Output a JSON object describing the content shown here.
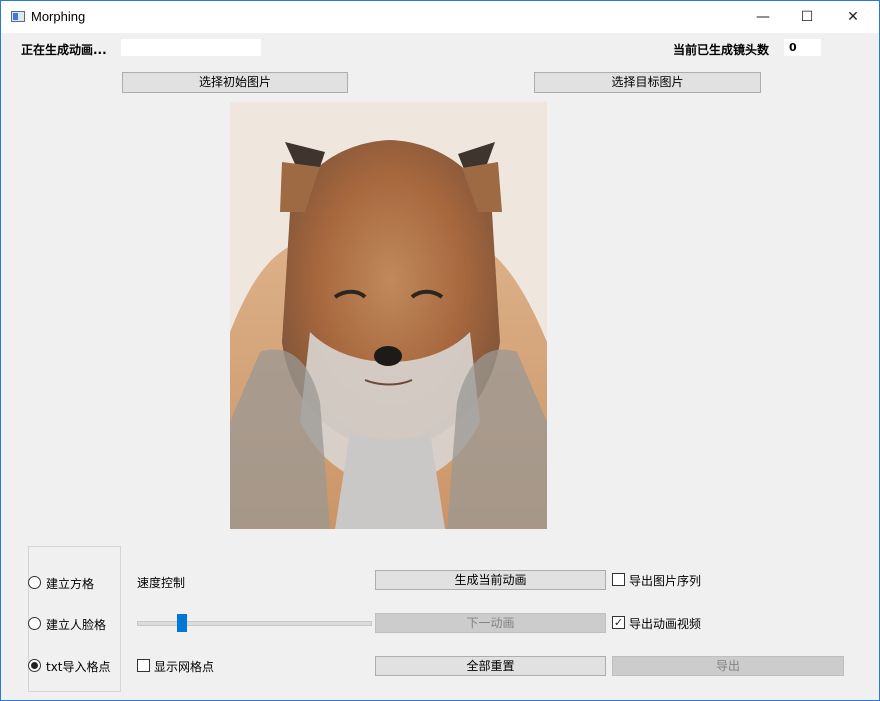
{
  "window": {
    "title": "Morphing",
    "controls": {
      "minimize": "—",
      "maximize": "☐",
      "close": "✕"
    }
  },
  "status": {
    "generating_label": "正在生成动画...",
    "frames_label": "当前已生成镜头数",
    "frames_value": "0"
  },
  "buttons": {
    "select_source": "选择初始图片",
    "select_target": "选择目标图片",
    "generate_current": "生成当前动画",
    "next_animation": "下一动画",
    "reset_all": "全部重置",
    "export": "导出"
  },
  "grid_mode": {
    "options": [
      {
        "label": "建立方格",
        "checked": false
      },
      {
        "label": "建立人脸格",
        "checked": false
      },
      {
        "label": "txt导入格点",
        "checked": true
      }
    ]
  },
  "speed": {
    "label": "速度控制",
    "value_fraction": 0.19
  },
  "checkboxes": {
    "show_grid": {
      "label": "显示网格点",
      "checked": false
    },
    "export_sequence": {
      "label": "导出图片序列",
      "checked": false
    },
    "export_video": {
      "label": "导出动画视频",
      "checked": true
    }
  },
  "colors": {
    "accent": "#0078d7",
    "window_border": "#2b79d6"
  }
}
